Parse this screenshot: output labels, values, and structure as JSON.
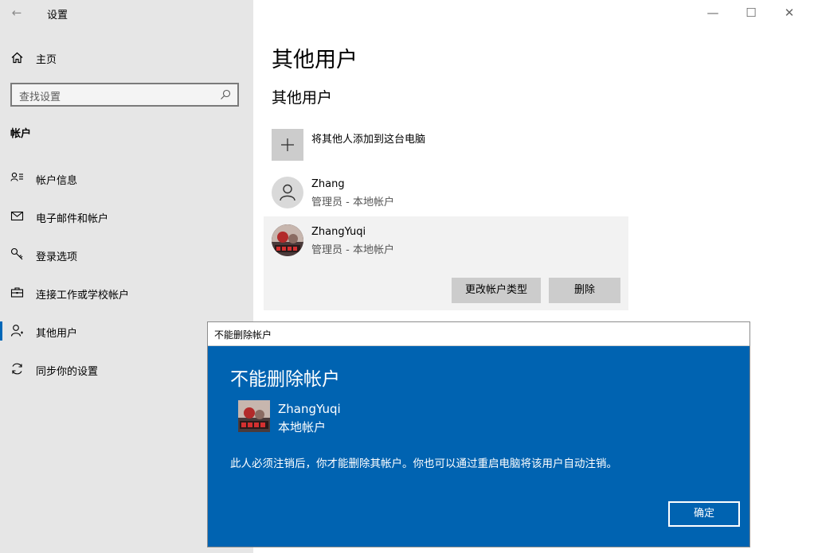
{
  "app": {
    "title": "设置",
    "back_icon": "back-arrow-icon"
  },
  "window_controls": {
    "minimize": "—",
    "maximize": "☐",
    "close": "✕"
  },
  "sidebar": {
    "home_label": "主页",
    "search_placeholder": "查找设置",
    "section_title": "帐户",
    "items": [
      {
        "label": "帐户信息",
        "icon": "account-info-icon"
      },
      {
        "label": "电子邮件和帐户",
        "icon": "mail-icon"
      },
      {
        "label": "登录选项",
        "icon": "key-icon"
      },
      {
        "label": "连接工作或学校帐户",
        "icon": "briefcase-icon"
      },
      {
        "label": "其他用户",
        "icon": "person-icon",
        "active": true
      },
      {
        "label": "同步你的设置",
        "icon": "sync-icon"
      }
    ]
  },
  "main": {
    "page_title": "其他用户",
    "section_title": "其他用户",
    "add_label": "将其他人添加到这台电脑",
    "users": [
      {
        "name": "Zhang",
        "role": "管理员 - 本地帐户"
      },
      {
        "name": "ZhangYuqi",
        "role": "管理员 - 本地帐户"
      }
    ],
    "change_type_label": "更改帐户类型",
    "delete_label": "删除"
  },
  "dialog": {
    "window_title": "不能删除帐户",
    "heading": "不能删除帐户",
    "user_name": "ZhangYuqi",
    "user_type": "本地帐户",
    "message": "此人必须注销后，你才能删除其帐户。你也可以通过重启电脑将该用户自动注销。",
    "ok_label": "确定"
  },
  "colors": {
    "accent": "#0063b1",
    "sidebar_bg": "#e6e6e6",
    "button_gray": "#cccccc"
  }
}
